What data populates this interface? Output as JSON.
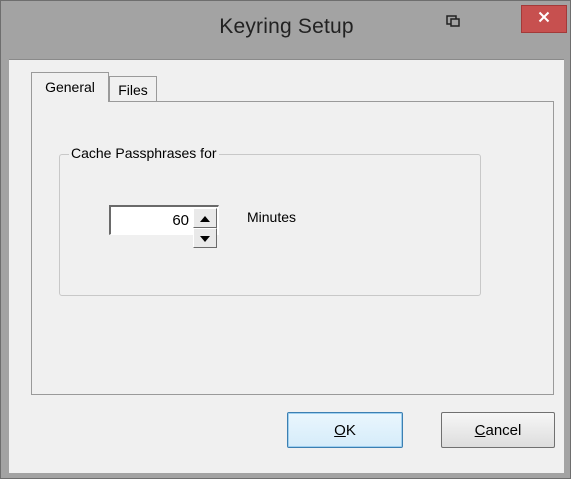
{
  "window": {
    "title": "Keyring Setup"
  },
  "titlebar": {
    "sys_icon": "restore-window-icon",
    "close_icon": "close-icon",
    "close_color": "#c7504f"
  },
  "tabs": [
    {
      "label": "General",
      "selected": true
    },
    {
      "label": "Files",
      "selected": false
    }
  ],
  "general": {
    "group_title": "Cache Passphrases for",
    "cache_value": "60",
    "units_label": "Minutes"
  },
  "buttons": {
    "ok": {
      "mnemonic": "O",
      "rest": "K"
    },
    "cancel": {
      "mnemonic": "C",
      "rest": "ancel"
    }
  }
}
